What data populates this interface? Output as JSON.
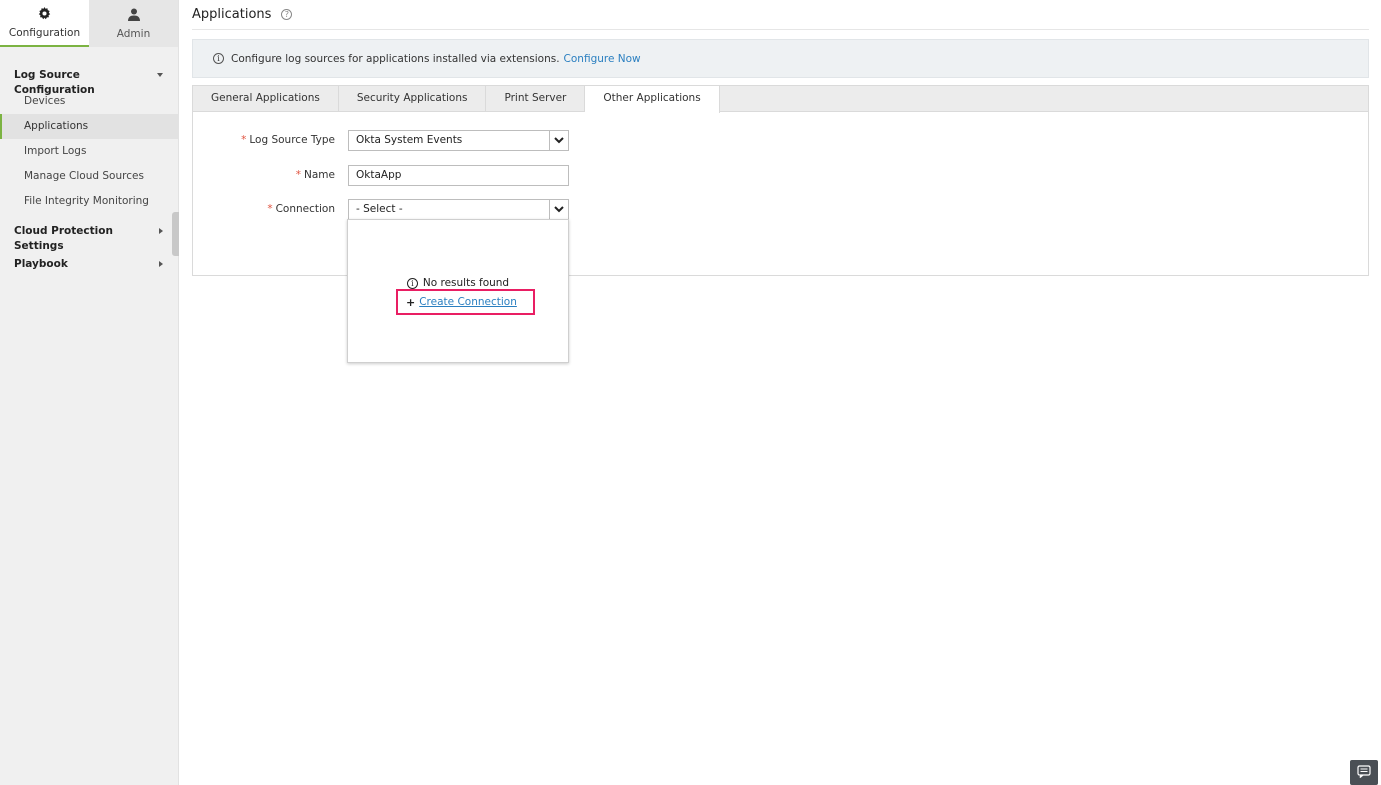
{
  "sidebar": {
    "top_tabs": [
      {
        "label": "Configuration",
        "icon": "gear-icon"
      },
      {
        "label": "Admin",
        "icon": "user-icon"
      }
    ],
    "groups": {
      "log_source": {
        "label": "Log Source Configuration",
        "items": [
          "Devices",
          "Applications",
          "Import Logs",
          "Manage Cloud Sources",
          "File Integrity Monitoring"
        ]
      },
      "cloud_protection": {
        "label": "Cloud Protection Settings"
      },
      "playbook": {
        "label": "Playbook"
      }
    },
    "active_item": "Applications"
  },
  "header": {
    "title": "Applications",
    "help_glyph": "?"
  },
  "info_bar": {
    "text": "Configure log sources for applications installed via extensions.",
    "link": "Configure Now",
    "icon_glyph": "i"
  },
  "tabs": [
    "General Applications",
    "Security Applications",
    "Print Server",
    "Other Applications"
  ],
  "active_tab": "Other Applications",
  "form": {
    "log_source_type": {
      "label": "Log Source Type",
      "value": "Okta System Events"
    },
    "name": {
      "label": "Name",
      "value": "OktaApp"
    },
    "connection": {
      "label": "Connection",
      "value": "- Select -"
    },
    "required_marker": "*"
  },
  "dropdown_popup": {
    "no_results": "No results found",
    "create_link": "Create Connection",
    "plus_glyph": "+",
    "info_glyph": "i",
    "highlight_color": "#e91e63"
  },
  "colors": {
    "accent": "#7cb342",
    "link": "#2a7fc0",
    "required": "#e0523f"
  }
}
